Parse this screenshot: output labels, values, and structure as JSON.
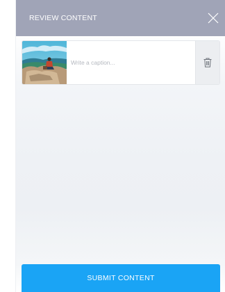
{
  "header": {
    "title": "REVIEW CONTENT",
    "close_icon": "close-icon"
  },
  "content_item": {
    "thumbnail": "image-thumbnail",
    "caption_value": "",
    "caption_placeholder": "Write a caption...",
    "delete_icon": "trash-icon"
  },
  "footer": {
    "submit_label": "SUBMIT CONTENT"
  },
  "colors": {
    "header_bg": "#a0a4b7",
    "submit_bg": "#1aa4f5",
    "delete_bg": "#eceef1"
  }
}
